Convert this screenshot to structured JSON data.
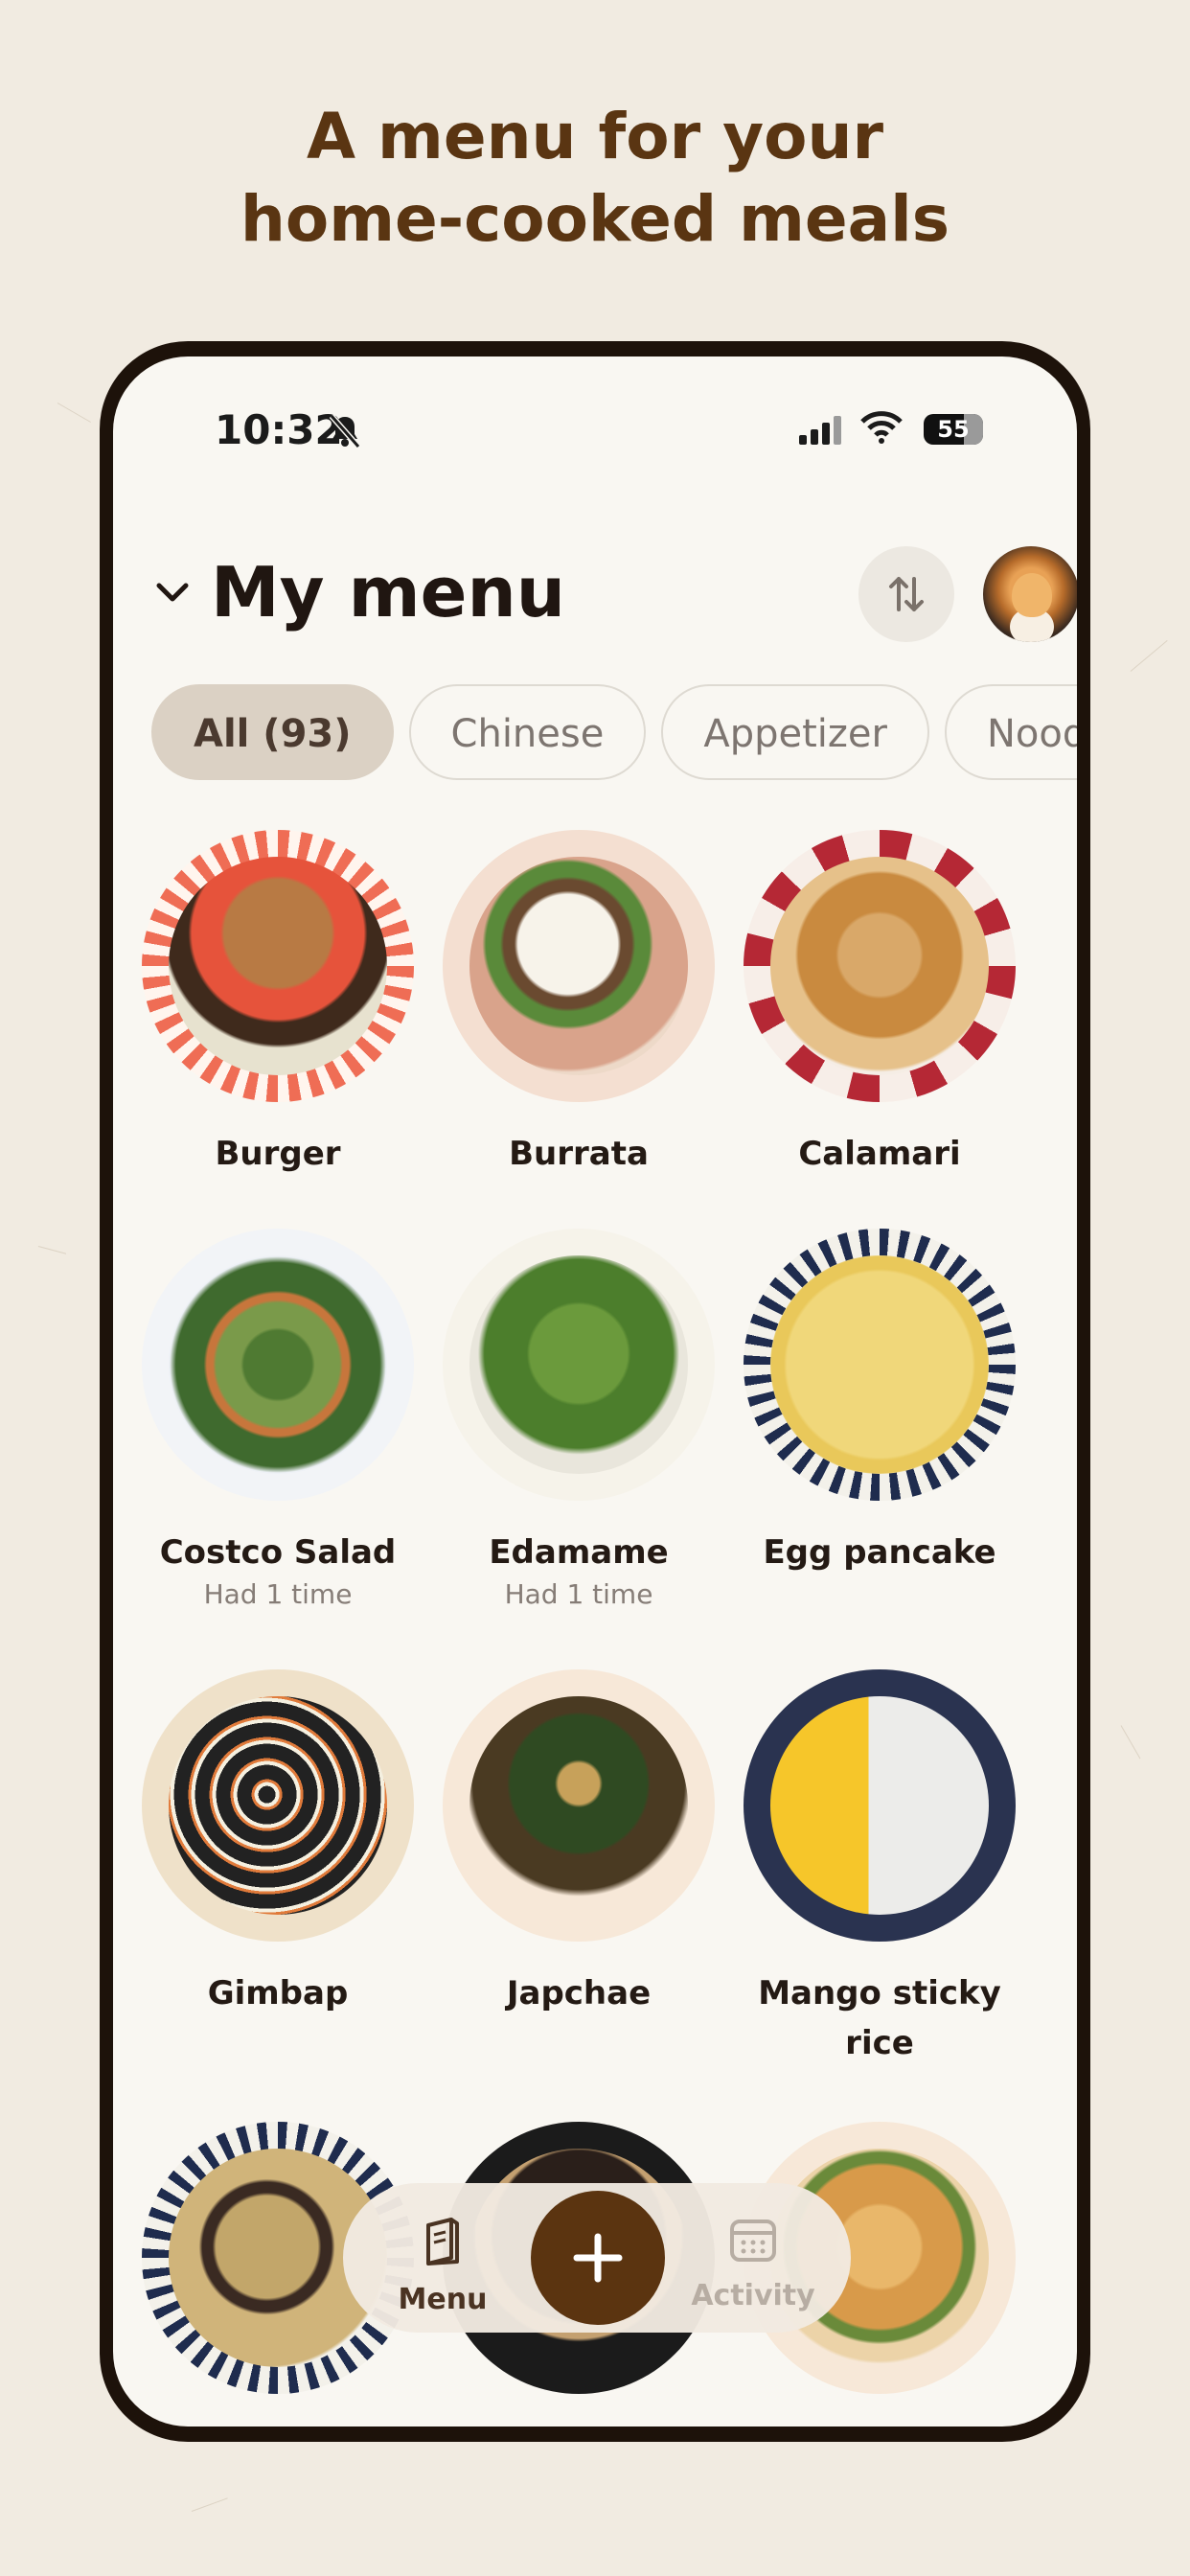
{
  "headline": {
    "line1": "A menu for your",
    "line2": "home-cooked meals"
  },
  "status_bar": {
    "time": "10:32",
    "battery": "55",
    "icons": [
      "bell-slash-icon",
      "signal-icon",
      "wifi-icon",
      "battery-icon"
    ]
  },
  "header": {
    "title": "My menu",
    "collapse_icon": "chevron-down-icon",
    "sort_icon": "sort-arrows-icon",
    "avatar": "cat-avatar"
  },
  "filters": [
    {
      "label": "All (93)",
      "active": true
    },
    {
      "label": "Chinese",
      "active": false
    },
    {
      "label": "Appetizer",
      "active": false
    },
    {
      "label": "Noodle",
      "active": false
    }
  ],
  "dishes": [
    {
      "name": "Burger",
      "sub": ""
    },
    {
      "name": "Burrata",
      "sub": ""
    },
    {
      "name": "Calamari",
      "sub": ""
    },
    {
      "name": "Costco Salad",
      "sub": "Had 1 time"
    },
    {
      "name": "Edamame",
      "sub": "Had 1 time"
    },
    {
      "name": "Egg pancake",
      "sub": ""
    },
    {
      "name": "Gimbap",
      "sub": ""
    },
    {
      "name": "Japchae",
      "sub": ""
    },
    {
      "name": "Mango sticky rice",
      "sub": ""
    },
    {
      "name": "",
      "sub": ""
    },
    {
      "name": "",
      "sub": ""
    },
    {
      "name": "",
      "sub": ""
    }
  ],
  "bottom_nav": {
    "menu_label": "Menu",
    "add_icon": "plus-icon",
    "activity_label": "Activity"
  },
  "colors": {
    "accent": "#5b3410",
    "headline": "#5a3512",
    "background": "#f1ebe1",
    "screen": "#f9f7f2"
  }
}
